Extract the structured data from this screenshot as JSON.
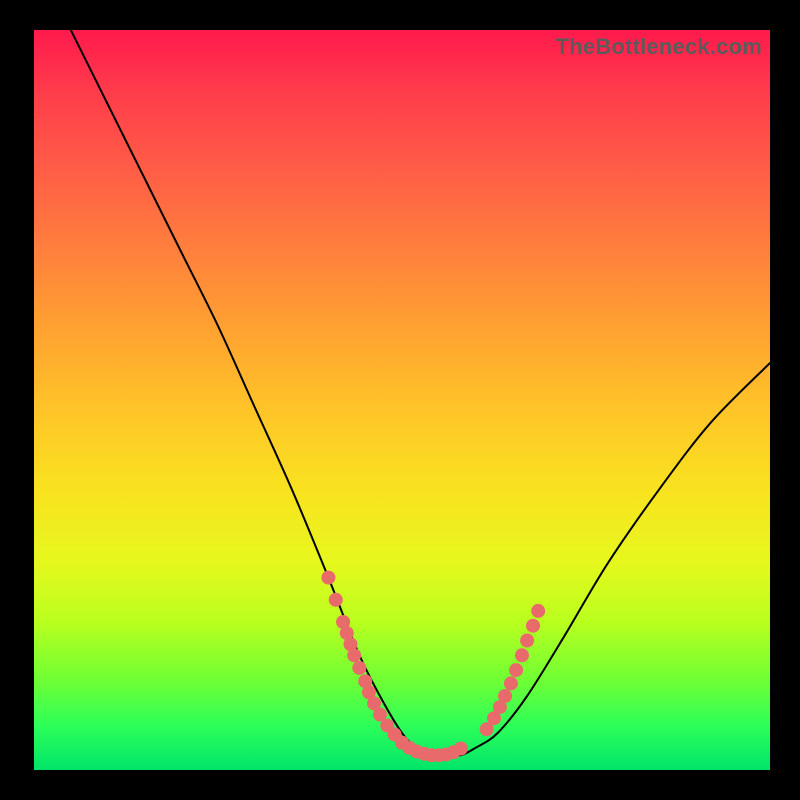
{
  "watermark": {
    "text": "TheBottleneck.com"
  },
  "chart_data": {
    "type": "line",
    "title": "",
    "xlabel": "",
    "ylabel": "",
    "xlim": [
      0,
      100
    ],
    "ylim": [
      0,
      100
    ],
    "grid": false,
    "legend": false,
    "series": [
      {
        "name": "curve",
        "x": [
          5,
          10,
          15,
          20,
          25,
          30,
          35,
          40,
          44,
          47,
          50,
          52,
          54,
          56,
          58,
          60,
          63,
          67,
          72,
          78,
          85,
          92,
          100
        ],
        "y": [
          100,
          90,
          80,
          70,
          60,
          49,
          38,
          26,
          16,
          10,
          5,
          3,
          2,
          2,
          2,
          3,
          5,
          10,
          18,
          28,
          38,
          47,
          55
        ]
      }
    ],
    "markers": [
      {
        "name": "left-cluster",
        "points": [
          [
            40,
            26
          ],
          [
            41,
            23
          ],
          [
            42,
            20
          ],
          [
            42.5,
            18.5
          ],
          [
            43,
            17
          ],
          [
            43.5,
            15.5
          ],
          [
            44.2,
            13.8
          ],
          [
            45,
            12
          ],
          [
            45.5,
            10.5
          ],
          [
            46.2,
            9
          ],
          [
            47,
            7.5
          ],
          [
            48,
            6
          ],
          [
            49,
            4.8
          ]
        ]
      },
      {
        "name": "bottom-cluster",
        "points": [
          [
            50,
            3.7
          ],
          [
            51,
            3
          ],
          [
            52,
            2.5
          ],
          [
            53,
            2.2
          ],
          [
            54,
            2
          ],
          [
            55,
            2
          ],
          [
            56,
            2.1
          ],
          [
            57,
            2.4
          ],
          [
            58,
            2.9
          ]
        ]
      },
      {
        "name": "right-cluster",
        "points": [
          [
            61.5,
            5.5
          ],
          [
            62.5,
            7
          ],
          [
            63.3,
            8.5
          ],
          [
            64,
            10
          ],
          [
            64.8,
            11.7
          ],
          [
            65.5,
            13.5
          ],
          [
            66.3,
            15.5
          ],
          [
            67,
            17.5
          ],
          [
            67.8,
            19.5
          ],
          [
            68.5,
            21.5
          ]
        ]
      }
    ],
    "curve_color": "#000000",
    "marker_color": "#e86a6a",
    "marker_radius_px": 7
  }
}
